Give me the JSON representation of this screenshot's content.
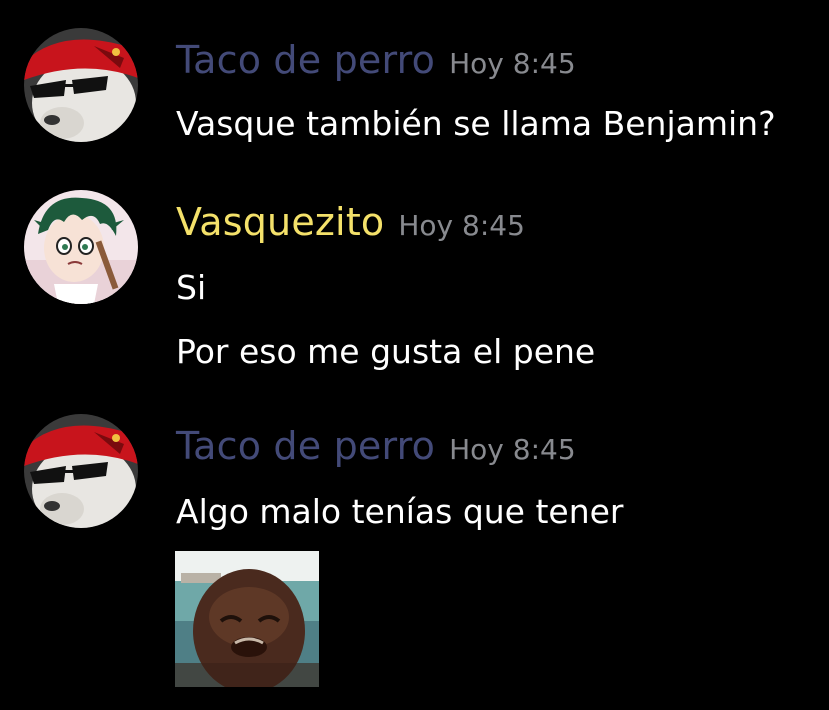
{
  "colors": {
    "background": "#000000",
    "taco_name": "#434a78",
    "vasquezito_name": "#f4e16a",
    "timestamp": "#888a8f",
    "message_text": "#ffffff"
  },
  "messages": [
    {
      "username": "Taco de perro",
      "timestamp": "Hoy 8:45",
      "avatar_icon": "dog-with-sunglasses-and-red-cap-avatar",
      "lines": [
        "Vasque también se llama Benjamin?"
      ]
    },
    {
      "username": "Vasquezito",
      "timestamp": "Hoy 8:45",
      "avatar_icon": "anime-boy-green-hair-avatar",
      "lines": [
        "Si",
        "Por eso me gusta el pene"
      ]
    },
    {
      "username": "Taco de perro",
      "timestamp": "Hoy 8:45",
      "avatar_icon": "dog-with-sunglasses-and-red-cap-avatar",
      "lines": [
        "Algo malo tenías que tener"
      ],
      "attachment_icon": "crying-person-meme-image"
    }
  ]
}
